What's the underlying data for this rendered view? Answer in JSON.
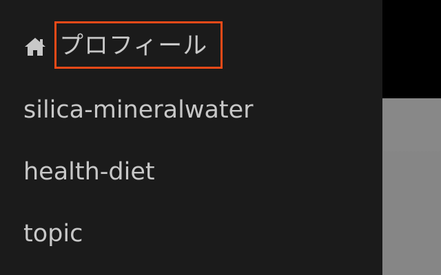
{
  "menu": {
    "items": [
      {
        "label": "プロフィール",
        "icon": "home-icon",
        "highlighted": true
      },
      {
        "label": "silica-mineralwater"
      },
      {
        "label": "health-diet"
      },
      {
        "label": "topic"
      }
    ]
  },
  "colors": {
    "drawer_bg": "#1b1b1b",
    "text": "#c8c8c8",
    "highlight_border": "#f04a18",
    "right_panel_top": "#000000",
    "right_panel_content": "#888888"
  }
}
